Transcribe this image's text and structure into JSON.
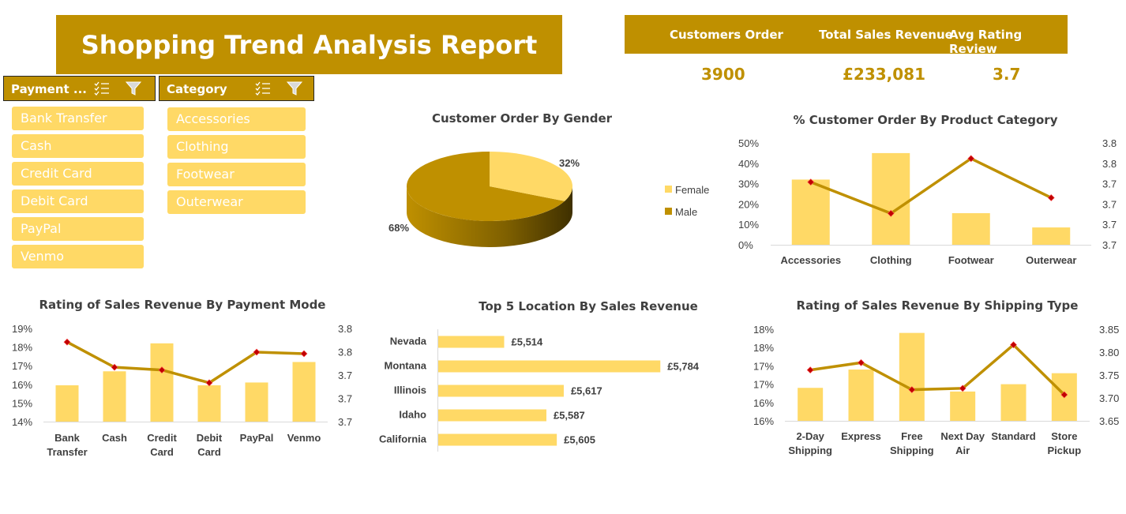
{
  "header": {
    "title": "Shopping Trend  Analysis Report"
  },
  "kpis": {
    "customers_order_label": "Customers Order",
    "customers_order_value": "3900",
    "total_sales_label": "Total Sales Revenue",
    "total_sales_value": "£233,081",
    "avg_rating_label": "Avg Rating Review",
    "avg_rating_value": "3.7"
  },
  "slicers": {
    "payment": {
      "label": "Payment ...",
      "items": [
        "Bank Transfer",
        "Cash",
        "Credit Card",
        "Debit Card",
        "PayPal",
        "Venmo"
      ]
    },
    "category": {
      "label": "Category",
      "items": [
        "Accessories",
        "Clothing",
        "Footwear",
        "Outerwear"
      ]
    }
  },
  "colors": {
    "gold": "#bf9000",
    "light_gold": "#ffd966",
    "marker": "#c00000",
    "text": "#404040"
  },
  "chart_data": [
    {
      "id": "gender",
      "type": "pie",
      "title": "Customer Order By Gender",
      "categories": [
        "Female",
        "Male"
      ],
      "values": [
        32,
        68
      ],
      "labels": [
        "32%",
        "68%"
      ],
      "legend": "right"
    },
    {
      "id": "category",
      "type": "bar",
      "title": "% Customer Order By Product Category",
      "categories": [
        "Accessories",
        "Clothing",
        "Footwear",
        "Outerwear"
      ],
      "series": [
        {
          "kind": "bar",
          "values": [
            32,
            45,
            15.5,
            8.5
          ]
        },
        {
          "kind": "line",
          "values": [
            3.76,
            3.72,
            3.79,
            3.74
          ]
        }
      ],
      "yticks": [
        "0%",
        "10%",
        "20%",
        "30%",
        "40%",
        "50%"
      ],
      "y2ticks": [
        "3.7",
        "3.7",
        "3.7",
        "3.7",
        "3.8",
        "3.8"
      ],
      "ylim": [
        0,
        50
      ],
      "y2lim": [
        3.68,
        3.81
      ]
    },
    {
      "id": "payment",
      "type": "bar",
      "title": "Rating of Sales Revenue By Payment Mode",
      "categories": [
        "Bank\nTransfer",
        "Cash",
        "Credit\nCard",
        "Debit\nCard",
        "PayPal",
        "Venmo"
      ],
      "series": [
        {
          "kind": "bar",
          "values": [
            15.95,
            16.7,
            18.2,
            15.95,
            16.1,
            17.2
          ]
        },
        {
          "kind": "line",
          "values": [
            3.805,
            3.74,
            3.733,
            3.7,
            3.779,
            3.775
          ]
        }
      ],
      "yticks": [
        "14%",
        "15%",
        "16%",
        "17%",
        "18%",
        "19%"
      ],
      "y2ticks": [
        "3.7",
        "3.7",
        "3.7",
        "3.8",
        "3.8"
      ],
      "ylim": [
        14,
        19
      ],
      "y2lim": [
        3.6,
        3.84
      ]
    },
    {
      "id": "location",
      "type": "bar",
      "orientation": "horizontal",
      "title": "Top 5 Location By Sales Revenue",
      "categories": [
        "Nevada",
        "Montana",
        "Illinois",
        "Idaho",
        "California"
      ],
      "values": [
        5514,
        5784,
        5617,
        5587,
        5605
      ],
      "labels": [
        "£5,514",
        "£5,784",
        "£5,617",
        "£5,587",
        "£5,605"
      ],
      "xlim": [
        5400,
        5800
      ]
    },
    {
      "id": "shipping",
      "type": "bar",
      "title": "Rating of Sales Revenue By Shipping Type",
      "categories": [
        "2-Day\nShipping",
        "Express",
        "Free\nShipping",
        "Next Day\nAir",
        "Standard",
        "Store\nPickup"
      ],
      "series": [
        {
          "kind": "bar",
          "values": [
            16.4,
            16.9,
            17.9,
            16.3,
            16.5,
            16.8
          ]
        },
        {
          "kind": "line",
          "values": [
            3.761,
            3.777,
            3.718,
            3.721,
            3.816,
            3.707
          ]
        }
      ],
      "yticks": [
        "16%",
        "16%",
        "17%",
        "17%",
        "18%",
        "18%"
      ],
      "y2ticks": [
        "3.65",
        "3.70",
        "3.75",
        "3.80",
        "3.85"
      ],
      "ylim": [
        15.5,
        18.0
      ],
      "y2lim": [
        3.65,
        3.85
      ]
    }
  ]
}
